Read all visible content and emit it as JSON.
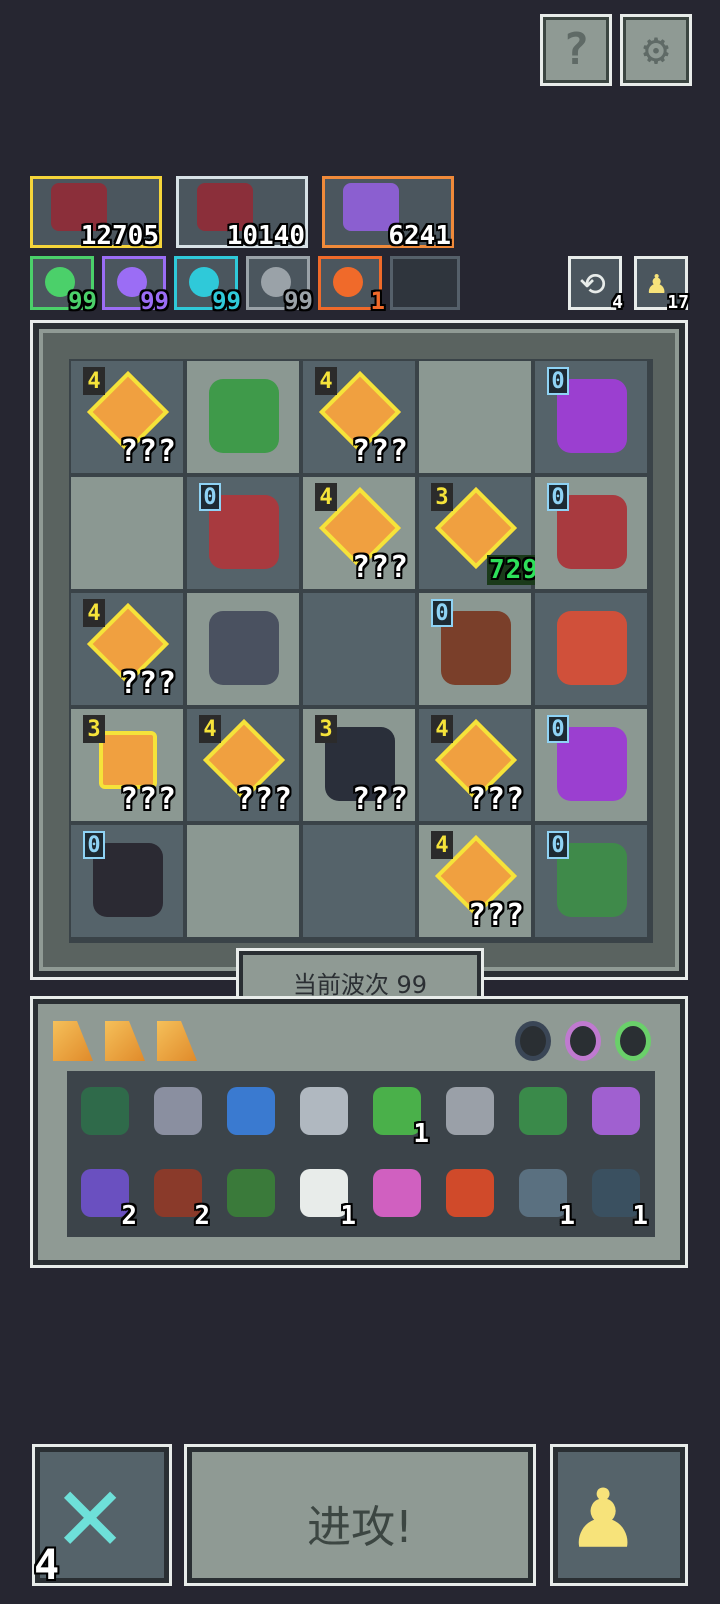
{
  "top_buttons": {
    "help_icon": "question-icon",
    "settings_icon": "gear-icon"
  },
  "units": [
    {
      "value": "12705",
      "border": "#f5d53a"
    },
    {
      "value": "10140",
      "border": "#d7e1e6"
    },
    {
      "value": "6241",
      "border": "#f08a3a"
    }
  ],
  "resources": [
    {
      "icon": "green-gem-icon",
      "value": "99",
      "color": "#4bd06a"
    },
    {
      "icon": "purple-bolt-icon",
      "value": "99",
      "color": "#9b6df5"
    },
    {
      "icon": "cyan-spiral-icon",
      "value": "99",
      "color": "#2fc9d9"
    },
    {
      "icon": "grey-wing-icon",
      "value": "99",
      "color": "#9aa2a8"
    },
    {
      "icon": "orange-flame-icon",
      "value": "1",
      "color": "#f06a2a"
    }
  ],
  "side_stats": [
    {
      "icon": "refresh-icon",
      "value": "4"
    },
    {
      "icon": "pawn-icon",
      "value": "17"
    }
  ],
  "grid": {
    "cells": [
      {
        "type": "crystal",
        "level": "4",
        "text": "???",
        "lvl_style": "y"
      },
      {
        "type": "monster",
        "kind": "green-tree-monster-icon"
      },
      {
        "type": "crystal",
        "level": "4",
        "text": "???",
        "lvl_style": "y"
      },
      {
        "type": "empty"
      },
      {
        "type": "monster",
        "kind": "purple-dragon-icon",
        "level": "0"
      },
      {
        "type": "empty"
      },
      {
        "type": "monster",
        "kind": "red-dragon-icon",
        "level": "0"
      },
      {
        "type": "crystal",
        "level": "4",
        "text": "???",
        "lvl_style": "y"
      },
      {
        "type": "crystal",
        "level": "3",
        "text": "729",
        "lvl_style": "y",
        "green": true
      },
      {
        "type": "monster",
        "kind": "red-dragon-icon",
        "level": "0"
      },
      {
        "type": "crystal",
        "level": "4",
        "text": "???",
        "lvl_style": "y"
      },
      {
        "type": "monster",
        "kind": "rock-golem-icon"
      },
      {
        "type": "empty"
      },
      {
        "type": "monster",
        "kind": "wooden-totem-icon",
        "level": "0"
      },
      {
        "type": "monster",
        "kind": "spiky-plant-icon"
      },
      {
        "type": "crystal",
        "level": "3",
        "text": "???",
        "lvl_style": "y",
        "hex": true
      },
      {
        "type": "crystal",
        "level": "4",
        "text": "???",
        "lvl_style": "y"
      },
      {
        "type": "monster",
        "kind": "black-hole-cannon-icon",
        "level": "3",
        "text": "???"
      },
      {
        "type": "crystal",
        "level": "4",
        "text": "???",
        "lvl_style": "y"
      },
      {
        "type": "monster",
        "kind": "purple-dragon-icon",
        "level": "0"
      },
      {
        "type": "monster",
        "kind": "dark-haired-girl-icon",
        "level": "0"
      },
      {
        "type": "empty"
      },
      {
        "type": "empty"
      },
      {
        "type": "crystal",
        "level": "4",
        "text": "???",
        "lvl_style": "y"
      },
      {
        "type": "monster",
        "kind": "green-minotaur-icon",
        "level": "0"
      }
    ]
  },
  "wave_label": "当前波次 99",
  "inventory_tabs": [
    "crystal-shard-icon",
    "crystal-shard-icon",
    "crystal-shard-icon"
  ],
  "inventory_filters": [
    "bug-icon",
    "egg-ring-icon",
    "green-ring-icon"
  ],
  "inventory": [
    {
      "icon": "turtle-shell-icon",
      "count": ""
    },
    {
      "icon": "pickaxe-icon",
      "count": ""
    },
    {
      "icon": "blue-feather-icon",
      "count": ""
    },
    {
      "icon": "dagger-icon",
      "count": ""
    },
    {
      "icon": "green-flask-icon",
      "count": "1"
    },
    {
      "icon": "slingshot-icon",
      "count": ""
    },
    {
      "icon": "green-spear-icon",
      "count": ""
    },
    {
      "icon": "purple-axe-icon",
      "count": ""
    },
    {
      "icon": "potion-jar-icon",
      "count": "2"
    },
    {
      "icon": "stone-tablet-icon",
      "count": "2"
    },
    {
      "icon": "green-chest-icon",
      "count": ""
    },
    {
      "icon": "white-fang-icon",
      "count": "1"
    },
    {
      "icon": "pink-arrow-icon",
      "count": ""
    },
    {
      "icon": "fire-card-icon",
      "count": ""
    },
    {
      "icon": "red-crossbow-icon",
      "count": "1"
    },
    {
      "icon": "dark-crossbow-icon",
      "count": "1"
    }
  ],
  "bottom": {
    "cancel_count": "4",
    "attack_label": "进攻!"
  }
}
